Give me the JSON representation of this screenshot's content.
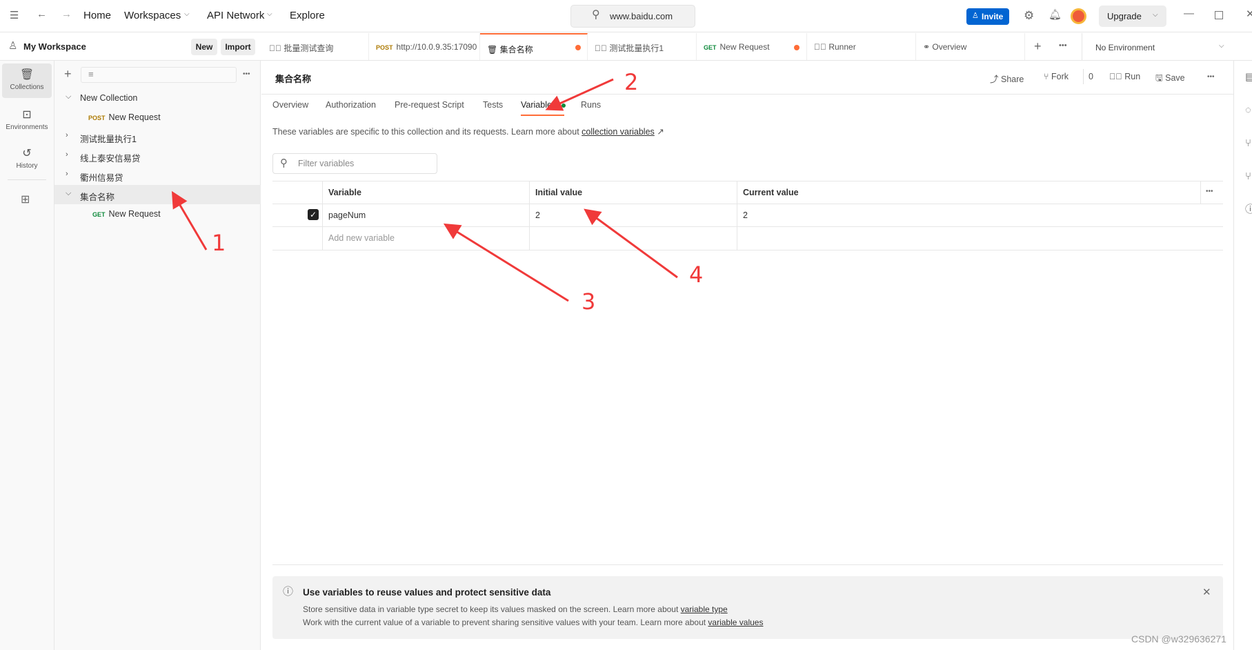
{
  "topbar": {
    "nav": [
      "Home",
      "Workspaces",
      "API Network",
      "Explore"
    ],
    "search": "www.baidu.com",
    "invite": "Invite",
    "upgrade": "Upgrade"
  },
  "workspace": {
    "name": "My Workspace",
    "new": "New",
    "import": "Import"
  },
  "tabs": [
    {
      "method": "",
      "label": "批量测试查询"
    },
    {
      "method": "POST",
      "label": "http://10.0.9.35:17090"
    },
    {
      "method": "",
      "label": "集合名称",
      "active": true,
      "unsaved": true
    },
    {
      "method": "",
      "label": "测试批量执行1"
    },
    {
      "method": "GET",
      "label": "New Request",
      "unsaved": true
    },
    {
      "method": "",
      "label": "Runner"
    },
    {
      "method": "",
      "label": "Overview"
    }
  ],
  "environment": "No Environment",
  "rail": [
    {
      "label": "Collections",
      "icon": "collections-icon"
    },
    {
      "label": "Environments",
      "icon": "environments-icon"
    },
    {
      "label": "History",
      "icon": "history-icon"
    }
  ],
  "tree": [
    {
      "label": "New Collection",
      "expanded": true
    },
    {
      "method": "POST",
      "label": "New Request"
    },
    {
      "label": "测试批量执行1"
    },
    {
      "label": "线上泰安信易贷"
    },
    {
      "label": "衢州信易贷"
    },
    {
      "label": "集合名称",
      "expanded": true,
      "selected": true
    },
    {
      "method": "GET",
      "label": "New Request"
    }
  ],
  "collection": {
    "title": "集合名称",
    "actions": {
      "share": "Share",
      "fork": "Fork",
      "fork_count": "0",
      "run": "Run",
      "save": "Save"
    },
    "subtabs": [
      "Overview",
      "Authorization",
      "Pre-request Script",
      "Tests",
      "Variables",
      "Runs"
    ],
    "description": "These variables are specific to this collection and its requests. Learn more about ",
    "description_link": "collection variables",
    "filter_placeholder": "Filter variables",
    "columns": [
      "Variable",
      "Initial value",
      "Current value"
    ],
    "rows": [
      {
        "enabled": true,
        "variable": "pageNum",
        "initial": "2",
        "current": "2"
      }
    ],
    "add_placeholder": "Add new variable"
  },
  "info": {
    "title": "Use variables to reuse values and protect sensitive data",
    "line1": "Store sensitive data in variable type secret to keep its values masked on the screen. Learn more about ",
    "link1": "variable type",
    "line2": "Work with the current value of a variable to prevent sharing sensitive values with your team. Learn more about ",
    "link2": "variable values"
  },
  "annotations": [
    "1",
    "2",
    "3",
    "4"
  ],
  "watermark": "CSDN @w329636271",
  "colors": {
    "accent": "#ff6c37",
    "invite": "#0265d2",
    "annotation": "#f03a3a",
    "get": "#0f8a3c",
    "post": "#ad7a03"
  }
}
